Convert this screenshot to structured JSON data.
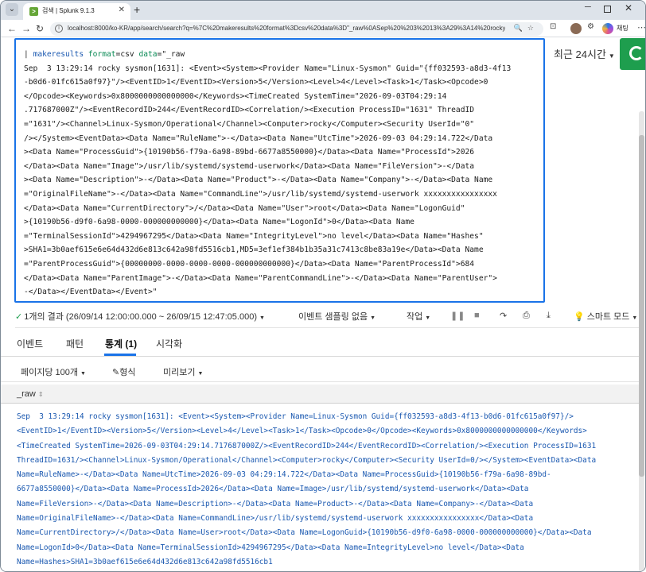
{
  "browser": {
    "tab_title": "검색 | Splunk 9.1.3",
    "url": "localhost:8000/ko-KR/app/search/search?q=%7C%20makeresults%20format%3Dcsv%20data%3D\"_raw%0ASep%20%203%2013%3A29%3A14%20rocky...",
    "copilot_label": "채팅"
  },
  "search": {
    "query_line1_pipe": "| ",
    "query_line1_cmd": "makeresults",
    "query_line1_arg1": " format",
    "query_line1_val1": "=csv ",
    "query_line1_arg2": "data",
    "query_line1_val2": "=\"_raw",
    "query_lines": [
      "Sep  3 13:29:14 rocky sysmon[1631]: <Event><System><Provider Name=\"Linux-Sysmon\" Guid=\"{ff032593-a8d3-4f13",
      "-b0d6-01fc615a0f97}\"/><EventID>1</EventID><Version>5</Version><Level>4</Level><Task>1</Task><Opcode>0",
      "</Opcode><Keywords>0x8000000000000000</Keywords><TimeCreated SystemTime=\"2026-09-03T04:29:14",
      ".717687000Z\"/><EventRecordID>244</EventRecordID><Correlation/><Execution ProcessID=\"1631\" ThreadID",
      "=\"1631\"/><Channel>Linux-Sysmon/Operational</Channel><Computer>rocky</Computer><Security UserId=\"0\"",
      "/></System><EventData><Data Name=\"RuleName\">-</Data><Data Name=\"UtcTime\">2026-09-03 04:29:14.722</Data",
      "><Data Name=\"ProcessGuid\">{10190b56-f79a-6a98-89bd-6677a8550000}</Data><Data Name=\"ProcessId\">2026",
      "</Data><Data Name=\"Image\">/usr/lib/systemd/systemd-userwork</Data><Data Name=\"FileVersion\">-</Data",
      "><Data Name=\"Description\">-</Data><Data Name=\"Product\">-</Data><Data Name=\"Company\">-</Data><Data Name",
      "=\"OriginalFileName\">-</Data><Data Name=\"CommandLine\">/usr/lib/systemd/systemd-userwork xxxxxxxxxxxxxxxx",
      "</Data><Data Name=\"CurrentDirectory\">/</Data><Data Name=\"User\">root</Data><Data Name=\"LogonGuid\"",
      ">{10190b56-d9f0-6a98-0000-000000000000}</Data><Data Name=\"LogonId\">0</Data><Data Name",
      "=\"TerminalSessionId\">4294967295</Data><Data Name=\"IntegrityLevel\">no level</Data><Data Name=\"Hashes\"",
      ">SHA1=3b0aef615e6e64d432d6e813c642a98fd5516cb1,MD5=3ef1ef384b1b35a31c7413c8be83a19e</Data><Data Name",
      "=\"ParentProcessGuid\">{00000000-0000-0000-0000-000000000000}</Data><Data Name=\"ParentProcessId\">684",
      "</Data><Data Name=\"ParentImage\">-</Data><Data Name=\"ParentCommandLine\">-</Data><Data Name=\"ParentUser\">",
      "-</Data></EventData></Event>\""
    ]
  },
  "time_picker": {
    "label": "최근 24시간"
  },
  "status_bar": {
    "result_summary": "1개의 결과 (26/09/14 12:00:00.000 ~ 26/09/15 12:47:05.000)",
    "sampling": "이벤트 샘플링 없음",
    "job": "작업",
    "smart_mode": "스마트 모드"
  },
  "result_tabs": [
    {
      "label": "이벤트"
    },
    {
      "label": "패턴"
    },
    {
      "label": "통계 (1)"
    },
    {
      "label": "시각화"
    }
  ],
  "options_bar": {
    "per_page": "페이지당 100개",
    "format": "형식",
    "preview": "미리보기"
  },
  "table": {
    "column": "_raw",
    "row_lines": [
      "Sep  3 13:29:14 rocky sysmon[1631]: <Event><System><Provider Name=Linux-Sysmon Guid={ff032593-a8d3-4f13-b0d6-01fc615a0f97}/>",
      "<EventID>1</EventID><Version>5</Version><Level>4</Level><Task>1</Task><Opcode>0</Opcode><Keywords>0x8000000000000000</Keywords>",
      "<TimeCreated SystemTime=2026-09-03T04:29:14.717687000Z/><EventRecordID>244</EventRecordID><Correlation/><Execution ProcessID=1631",
      "ThreadID=1631/><Channel>Linux-Sysmon/Operational</Channel><Computer>rocky</Computer><Security UserId=0/></System><EventData><Data",
      "Name=RuleName>-</Data><Data Name=UtcTime>2026-09-03 04:29:14.722</Data><Data Name=ProcessGuid>{10190b56-f79a-6a98-89bd-",
      "6677a8550000}</Data><Data Name=ProcessId>2026</Data><Data Name=Image>/usr/lib/systemd/systemd-userwork</Data><Data",
      "Name=FileVersion>-</Data><Data Name=Description>-</Data><Data Name=Product>-</Data><Data Name=Company>-</Data><Data",
      "Name=OriginalFileName>-</Data><Data Name=CommandLine>/usr/lib/systemd/systemd-userwork xxxxxxxxxxxxxxxx</Data><Data",
      "Name=CurrentDirectory>/</Data><Data Name=User>root</Data><Data Name=LogonGuid>{10190b56-d9f0-6a98-0000-000000000000}</Data><Data",
      "Name=LogonId>0</Data><Data Name=TerminalSessionId>4294967295</Data><Data Name=IntegrityLevel>no level</Data><Data",
      "Name=Hashes>SHA1=3b0aef615e6e64d432d6e813c642a98fd5516cb1"
    ]
  }
}
